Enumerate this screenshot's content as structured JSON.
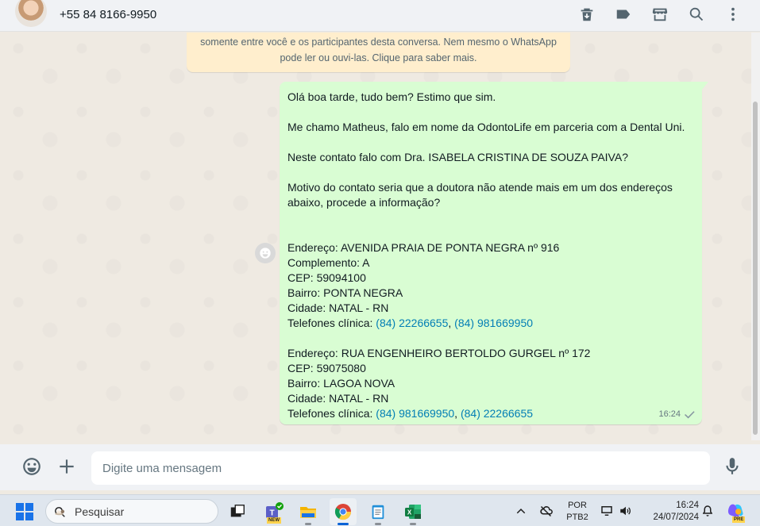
{
  "header": {
    "contact_name": "+55 84 8166-9950",
    "icons": [
      "delete-icon",
      "label-icon",
      "store-icon",
      "search-icon",
      "menu-icon"
    ]
  },
  "chat": {
    "encryption_notice": {
      "line1": "somente entre você e os participantes desta conversa. Nem mesmo o WhatsApp",
      "line2": "pode ler ou ouvi-las. Clique para saber mais."
    },
    "message": {
      "greeting": "Olá boa tarde, tudo bem? Estimo que sim.",
      "intro": "Me chamo Matheus, falo em nome da OdontoLife em parceria com a Dental Uni.",
      "question": "Neste contato falo com Dra. ISABELA CRISTINA DE SOUZA PAIVA?",
      "motive1": "Motivo do contato seria que a doutora não atende mais em um dos endereços",
      "motive2": "abaixo, procede a informação?",
      "address1": {
        "street": "Endereço: AVENIDA PRAIA DE PONTA NEGRA nº 916",
        "complement": "Complemento: A",
        "cep": "CEP: 59094100",
        "bairro": "Bairro: PONTA NEGRA",
        "cidade": "Cidade: NATAL - RN",
        "phones_label": "Telefones clínica: ",
        "phone1": "(84) 22266655",
        "sep": ", ",
        "phone2": "(84) 981669950"
      },
      "address2": {
        "street": "Endereço: RUA ENGENHEIRO BERTOLDO GURGEL nº 172",
        "cep": "CEP: 59075080",
        "bairro": "Bairro: LAGOA NOVA",
        "cidade": "Cidade: NATAL - RN",
        "phones_label": "Telefones clínica: ",
        "phone1": "(84) 981669950",
        "sep": ", ",
        "phone2": "(84) 22266655"
      },
      "time": "16:24",
      "status": "sent"
    }
  },
  "composer": {
    "placeholder": "Digite uma mensagem",
    "value": ""
  },
  "taskbar": {
    "search_label": "Pesquisar",
    "apps": [
      "widgets-app",
      "teams-app",
      "file-explorer-app",
      "chrome-app",
      "notepad-app",
      "excel-app"
    ],
    "teams_badge": "NEW",
    "language": {
      "line1": "POR",
      "line2": "PTB2"
    },
    "clock": {
      "time": "16:24",
      "date": "24/07/2024"
    },
    "copilot_badge": "PRE",
    "colors": {
      "accent": "#0b62d6",
      "bubble": "#d9fdd3",
      "link": "#027eb5"
    }
  }
}
